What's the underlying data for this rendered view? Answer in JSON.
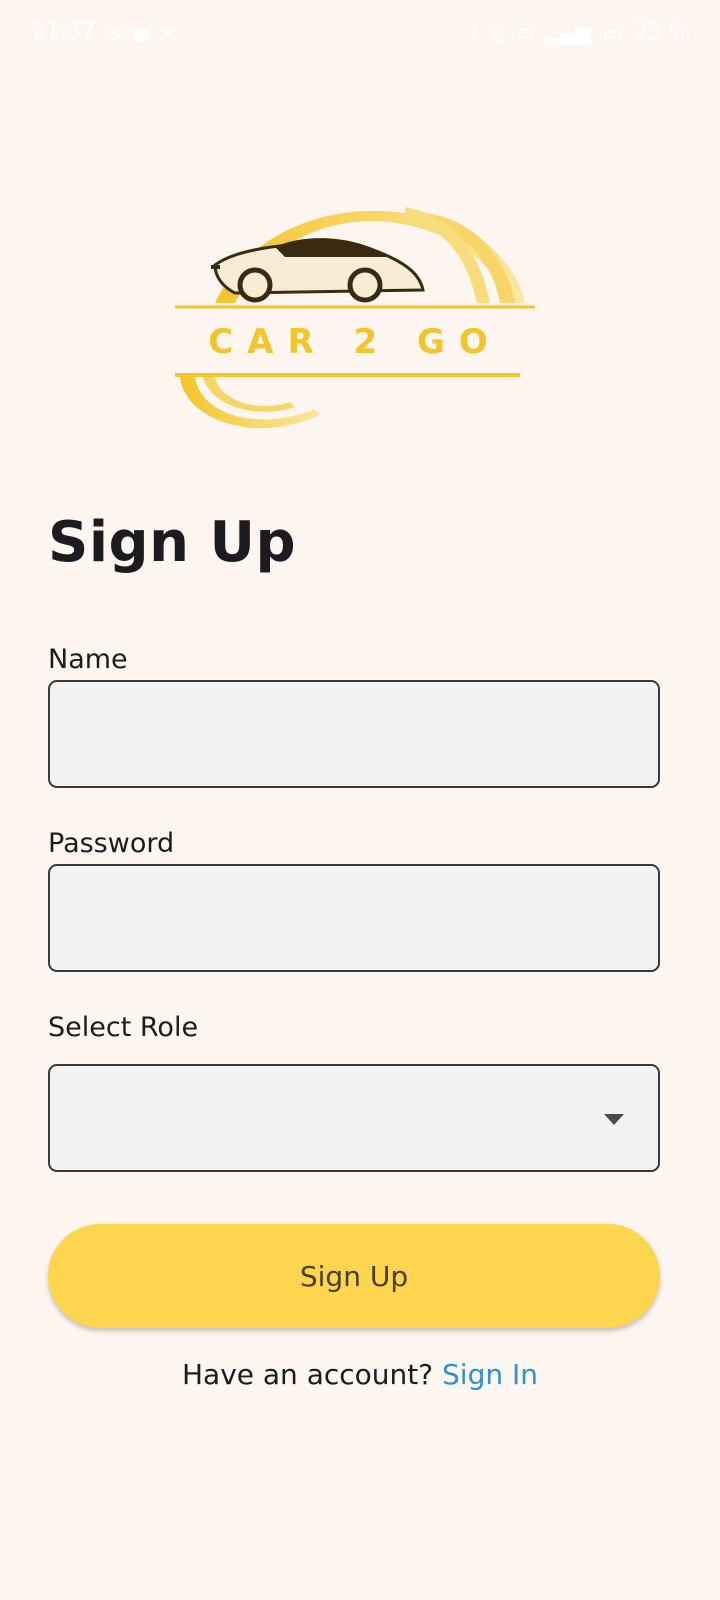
{
  "status_bar": {
    "time": "21:37",
    "battery": "23 %"
  },
  "logo": {
    "text": "CAR 2 GO"
  },
  "page": {
    "title": "Sign Up"
  },
  "form": {
    "name_label": "Name",
    "name_value": "",
    "password_label": "Password",
    "password_value": "",
    "role_label": "Select Role",
    "role_value": ""
  },
  "actions": {
    "signup_label": "Sign Up"
  },
  "footer": {
    "prompt": "Have an account? ",
    "signin_label": "Sign In"
  },
  "colors": {
    "background": "#fdf5f0",
    "accent": "#fdd54e",
    "link": "#2f8fd8",
    "logo_gold": "#f3c52b"
  }
}
